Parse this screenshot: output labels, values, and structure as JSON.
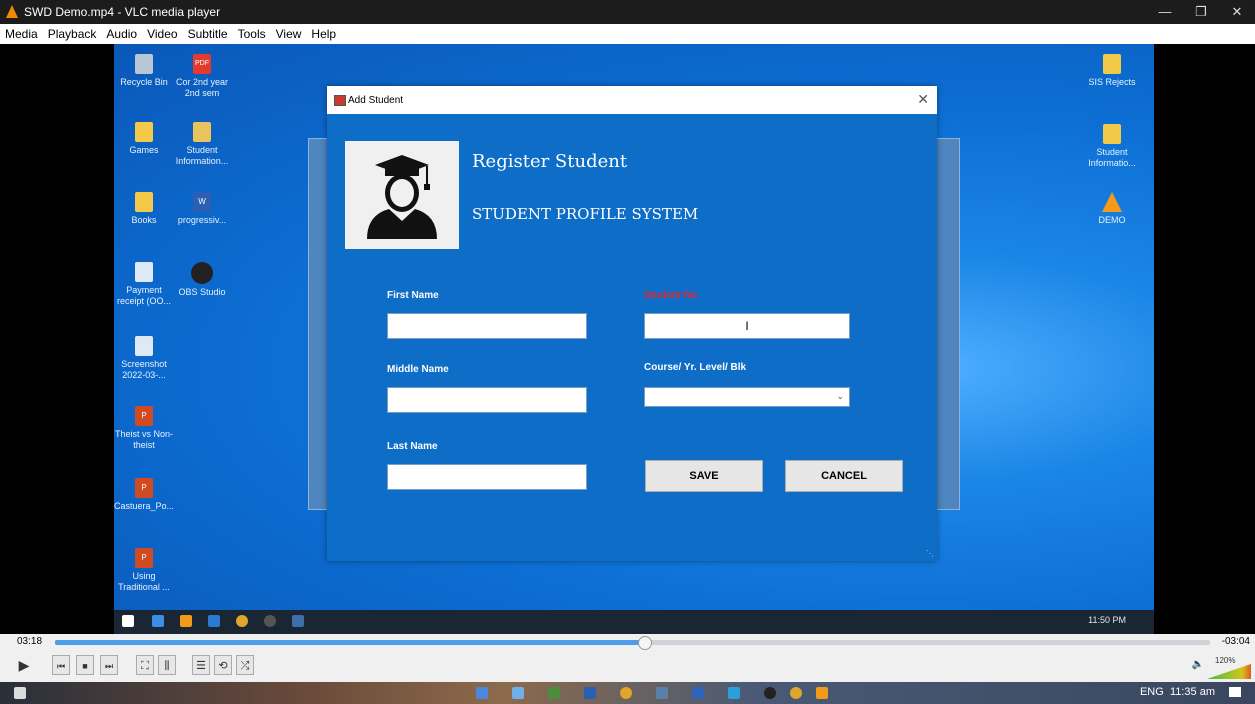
{
  "vlc": {
    "title": "SWD Demo.mp4 - VLC media player",
    "controls": {
      "minimize": "—",
      "restore": "❐",
      "close": "✕"
    },
    "menu": [
      "Media",
      "Playback",
      "Audio",
      "Video",
      "Subtitle",
      "Tools",
      "View",
      "Help"
    ],
    "elapsed": "03:18",
    "remaining": "-03:04",
    "progress_fraction": 0.51,
    "volume_label": "120%",
    "buttons": {
      "play": "▶",
      "prev": "⏮",
      "stop": "■",
      "next": "⏭",
      "fullscreen": "⛶",
      "ext_settings": "⫼",
      "playlist": "☰",
      "loop": "⟲",
      "random": "⤮",
      "volume": "🔈"
    }
  },
  "desktop": {
    "icons_left": [
      {
        "label": "Recycle Bin",
        "icon": "recycle-bin-icon"
      },
      {
        "label": "Cor 2nd year 2nd sem",
        "icon": "pdf-icon",
        "badge": "PDF"
      },
      {
        "label": "Games",
        "icon": "folder-icon"
      },
      {
        "label": "Student Information...",
        "icon": "folder-zip-icon"
      },
      {
        "label": "Books",
        "icon": "folder-icon"
      },
      {
        "label": "progressiv...",
        "icon": "word-icon",
        "badge": "W"
      },
      {
        "label": "Payment receipt (OO...",
        "icon": "image-icon"
      },
      {
        "label": "OBS Studio",
        "icon": "obs-icon"
      },
      {
        "label": "Screenshot 2022-03-...",
        "icon": "image-icon"
      },
      {
        "label": "Theist vs Non-theist",
        "icon": "powerpoint-icon",
        "badge": "P"
      },
      {
        "label": "Castuera_Po...",
        "icon": "powerpoint-icon",
        "badge": "P"
      },
      {
        "label": "Using Traditional ...",
        "icon": "powerpoint-icon",
        "badge": "P"
      }
    ],
    "icons_right": [
      {
        "label": "SIS Rejects",
        "icon": "folder-icon"
      },
      {
        "label": "Student Informatio...",
        "icon": "folder-icon"
      },
      {
        "label": "DEMO",
        "icon": "vlc-icon"
      }
    ],
    "taskbar_time": "11:50 PM"
  },
  "dialog": {
    "title": "Add Student",
    "close": "✕",
    "heading": "Register Student",
    "subheading": "STUDENT PROFILE SYSTEM",
    "fields": {
      "first_name": {
        "label": "First Name",
        "value": ""
      },
      "middle_name": {
        "label": "Middle Name",
        "value": ""
      },
      "last_name": {
        "label": "Last Name",
        "value": ""
      },
      "student_no": {
        "label": "Student No",
        "value": "I"
      },
      "course": {
        "label": "Course/ Yr. Level/ Blk",
        "value": ""
      }
    },
    "buttons": {
      "save": "SAVE",
      "cancel": "CANCEL"
    },
    "colors": {
      "background": "#0d6dc7",
      "required_label": "#e3262e"
    }
  },
  "host_taskbar": {
    "time": "11:35 am",
    "lang": "ENG"
  }
}
